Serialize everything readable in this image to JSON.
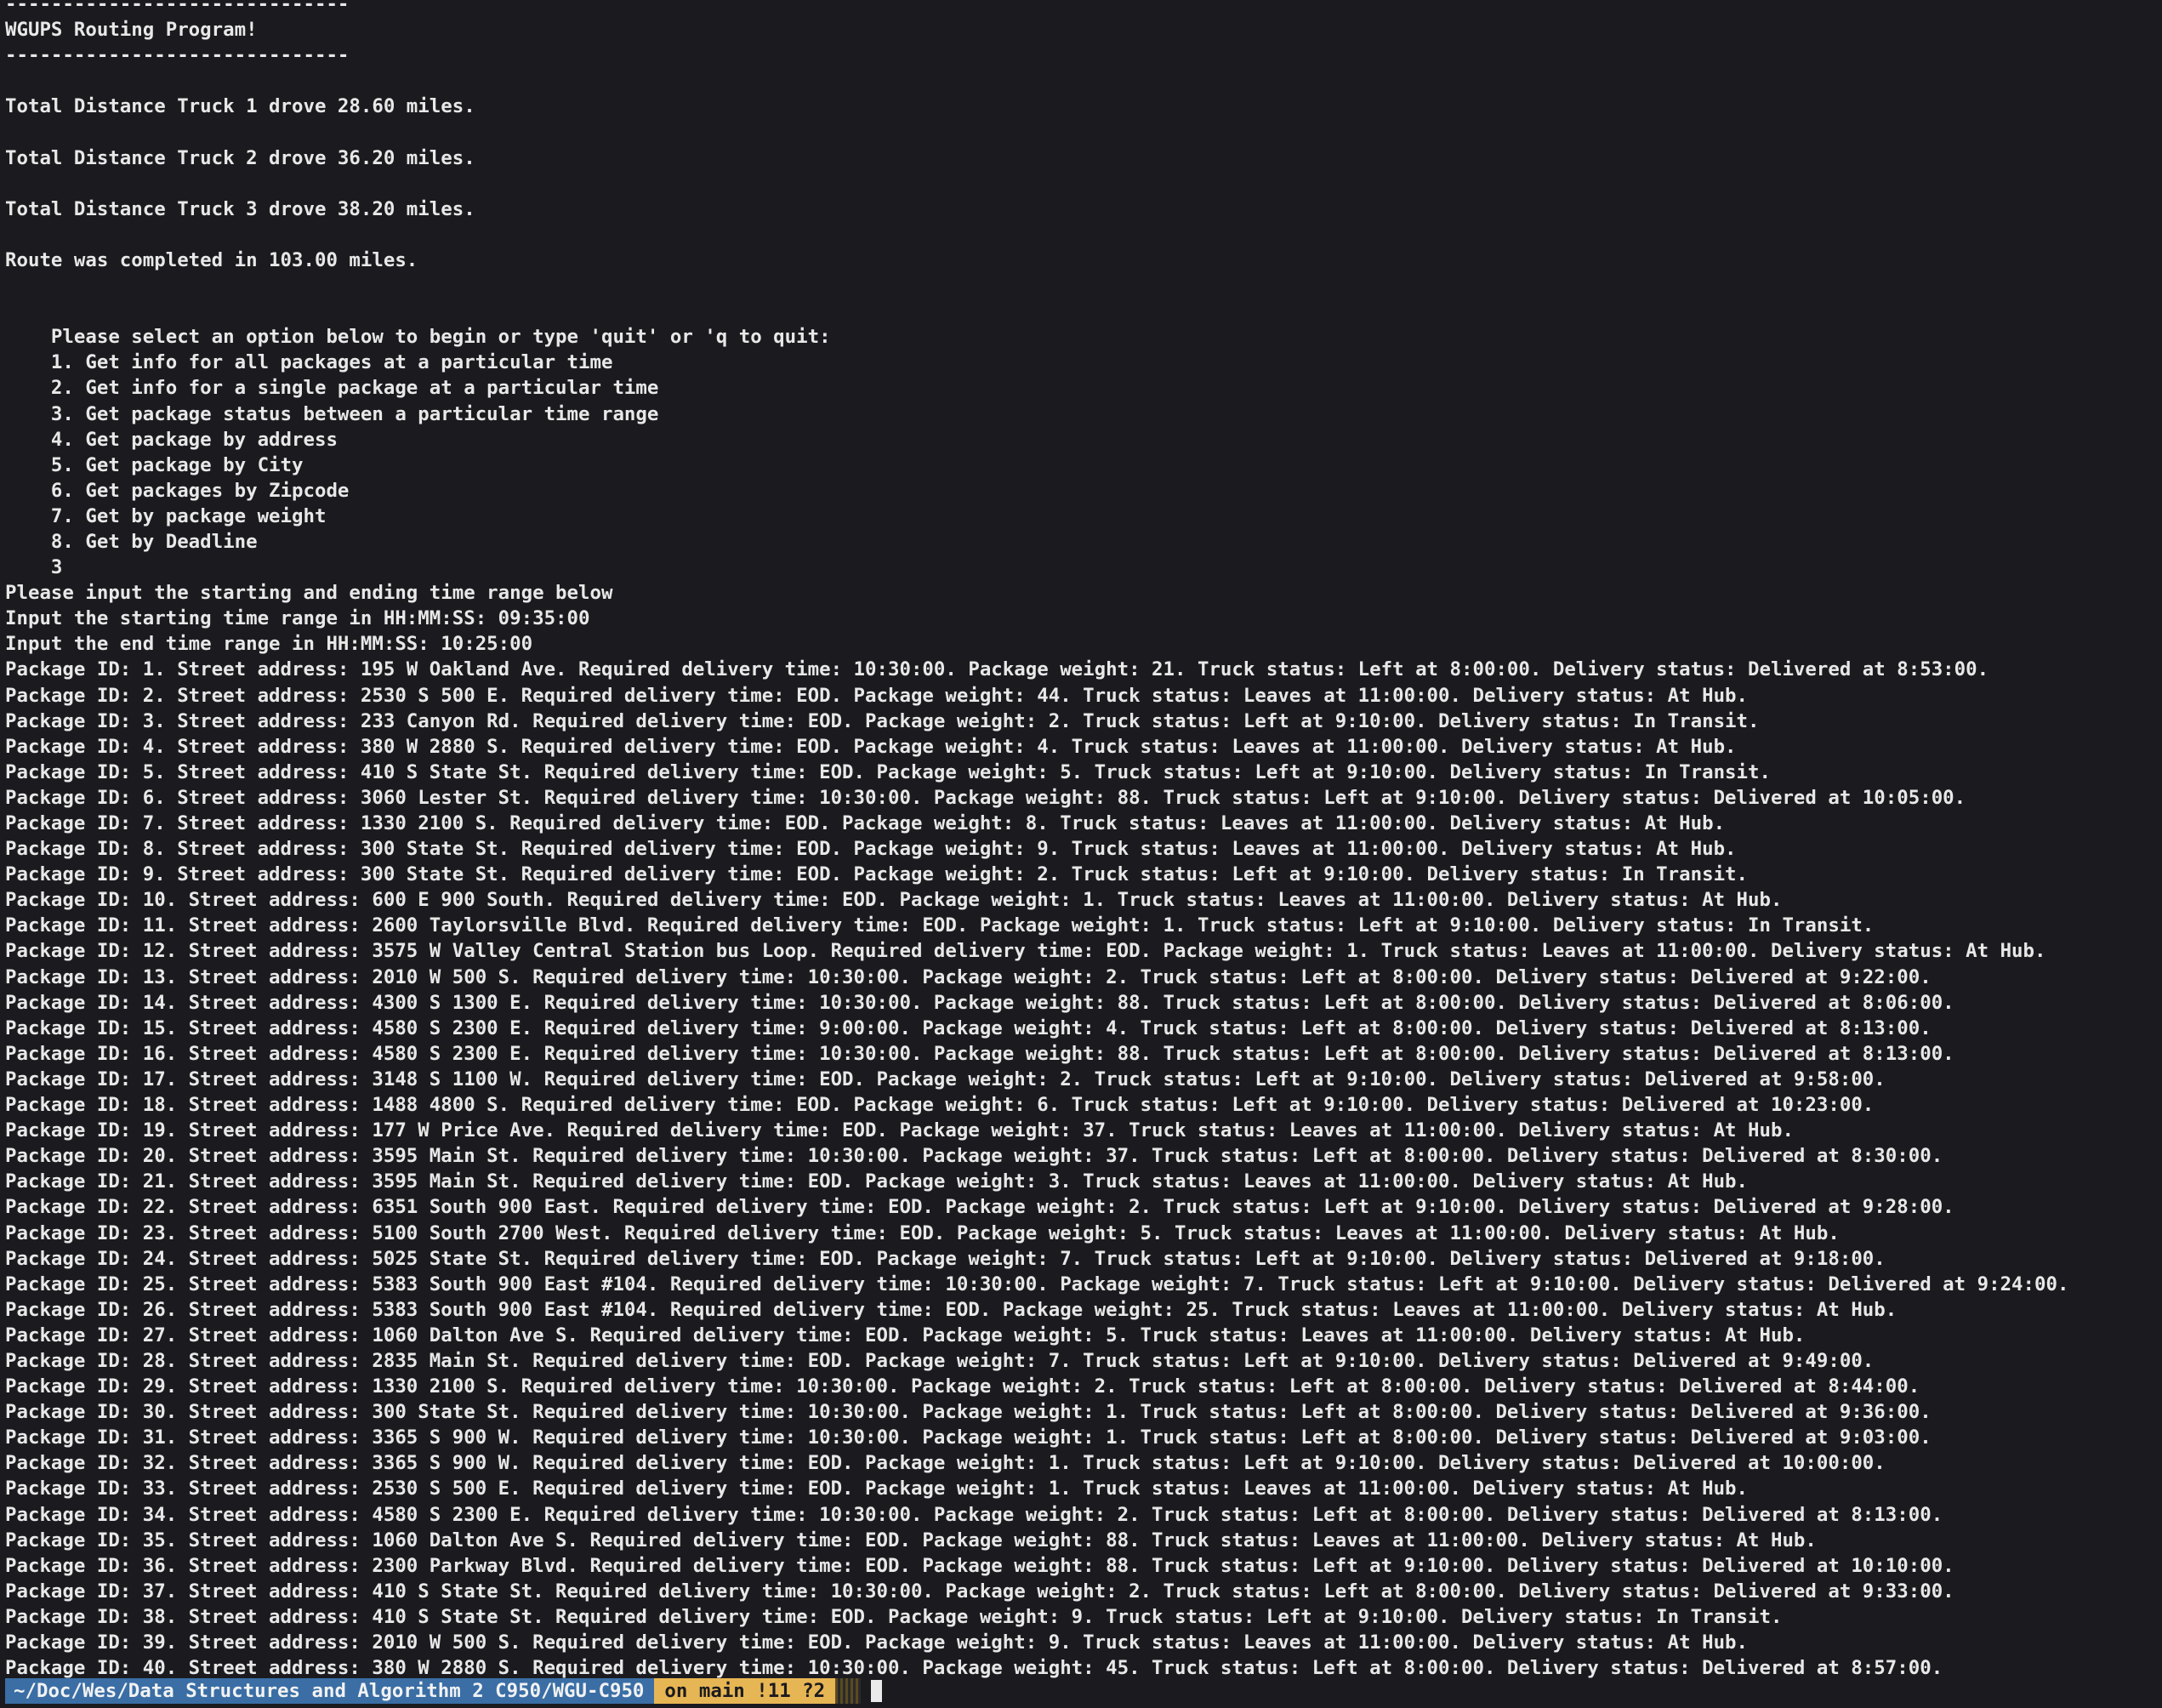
{
  "terminal": {
    "lines": [
      "------------------------------",
      "WGUPS Routing Program!",
      "------------------------------",
      "",
      "Total Distance Truck 1 drove 28.60 miles.",
      "",
      "Total Distance Truck 2 drove 36.20 miles.",
      "",
      "Total Distance Truck 3 drove 38.20 miles.",
      "",
      "Route was completed in 103.00 miles.",
      "",
      "",
      "    Please select an option below to begin or type 'quit' or 'q to quit:",
      "    1. Get info for all packages at a particular time",
      "    2. Get info for a single package at a particular time",
      "    3. Get package status between a particular time range",
      "    4. Get package by address",
      "    5. Get package by City",
      "    6. Get packages by Zipcode",
      "    7. Get by package weight",
      "    8. Get by Deadline",
      "    3",
      "Please input the starting and ending time range below",
      "Input the starting time range in HH:MM:SS: 09:35:00",
      "Input the end time range in HH:MM:SS: 10:25:00",
      "Package ID: 1. Street address: 195 W Oakland Ave. Required delivery time: 10:30:00. Package weight: 21. Truck status: Left at 8:00:00. Delivery status: Delivered at 8:53:00.",
      "Package ID: 2. Street address: 2530 S 500 E. Required delivery time: EOD. Package weight: 44. Truck status: Leaves at 11:00:00. Delivery status: At Hub.",
      "Package ID: 3. Street address: 233 Canyon Rd. Required delivery time: EOD. Package weight: 2. Truck status: Left at 9:10:00. Delivery status: In Transit.",
      "Package ID: 4. Street address: 380 W 2880 S. Required delivery time: EOD. Package weight: 4. Truck status: Leaves at 11:00:00. Delivery status: At Hub.",
      "Package ID: 5. Street address: 410 S State St. Required delivery time: EOD. Package weight: 5. Truck status: Left at 9:10:00. Delivery status: In Transit.",
      "Package ID: 6. Street address: 3060 Lester St. Required delivery time: 10:30:00. Package weight: 88. Truck status: Left at 9:10:00. Delivery status: Delivered at 10:05:00.",
      "Package ID: 7. Street address: 1330 2100 S. Required delivery time: EOD. Package weight: 8. Truck status: Leaves at 11:00:00. Delivery status: At Hub.",
      "Package ID: 8. Street address: 300 State St. Required delivery time: EOD. Package weight: 9. Truck status: Leaves at 11:00:00. Delivery status: At Hub.",
      "Package ID: 9. Street address: 300 State St. Required delivery time: EOD. Package weight: 2. Truck status: Left at 9:10:00. Delivery status: In Transit.",
      "Package ID: 10. Street address: 600 E 900 South. Required delivery time: EOD. Package weight: 1. Truck status: Leaves at 11:00:00. Delivery status: At Hub.",
      "Package ID: 11. Street address: 2600 Taylorsville Blvd. Required delivery time: EOD. Package weight: 1. Truck status: Left at 9:10:00. Delivery status: In Transit.",
      "Package ID: 12. Street address: 3575 W Valley Central Station bus Loop. Required delivery time: EOD. Package weight: 1. Truck status: Leaves at 11:00:00. Delivery status: At Hub.",
      "Package ID: 13. Street address: 2010 W 500 S. Required delivery time: 10:30:00. Package weight: 2. Truck status: Left at 8:00:00. Delivery status: Delivered at 9:22:00.",
      "Package ID: 14. Street address: 4300 S 1300 E. Required delivery time: 10:30:00. Package weight: 88. Truck status: Left at 8:00:00. Delivery status: Delivered at 8:06:00.",
      "Package ID: 15. Street address: 4580 S 2300 E. Required delivery time: 9:00:00. Package weight: 4. Truck status: Left at 8:00:00. Delivery status: Delivered at 8:13:00.",
      "Package ID: 16. Street address: 4580 S 2300 E. Required delivery time: 10:30:00. Package weight: 88. Truck status: Left at 8:00:00. Delivery status: Delivered at 8:13:00.",
      "Package ID: 17. Street address: 3148 S 1100 W. Required delivery time: EOD. Package weight: 2. Truck status: Left at 9:10:00. Delivery status: Delivered at 9:58:00.",
      "Package ID: 18. Street address: 1488 4800 S. Required delivery time: EOD. Package weight: 6. Truck status: Left at 9:10:00. Delivery status: Delivered at 10:23:00.",
      "Package ID: 19. Street address: 177 W Price Ave. Required delivery time: EOD. Package weight: 37. Truck status: Leaves at 11:00:00. Delivery status: At Hub.",
      "Package ID: 20. Street address: 3595 Main St. Required delivery time: 10:30:00. Package weight: 37. Truck status: Left at 8:00:00. Delivery status: Delivered at 8:30:00.",
      "Package ID: 21. Street address: 3595 Main St. Required delivery time: EOD. Package weight: 3. Truck status: Leaves at 11:00:00. Delivery status: At Hub.",
      "Package ID: 22. Street address: 6351 South 900 East. Required delivery time: EOD. Package weight: 2. Truck status: Left at 9:10:00. Delivery status: Delivered at 9:28:00.",
      "Package ID: 23. Street address: 5100 South 2700 West. Required delivery time: EOD. Package weight: 5. Truck status: Leaves at 11:00:00. Delivery status: At Hub.",
      "Package ID: 24. Street address: 5025 State St. Required delivery time: EOD. Package weight: 7. Truck status: Left at 9:10:00. Delivery status: Delivered at 9:18:00.",
      "Package ID: 25. Street address: 5383 South 900 East #104. Required delivery time: 10:30:00. Package weight: 7. Truck status: Left at 9:10:00. Delivery status: Delivered at 9:24:00.",
      "Package ID: 26. Street address: 5383 South 900 East #104. Required delivery time: EOD. Package weight: 25. Truck status: Leaves at 11:00:00. Delivery status: At Hub.",
      "Package ID: 27. Street address: 1060 Dalton Ave S. Required delivery time: EOD. Package weight: 5. Truck status: Leaves at 11:00:00. Delivery status: At Hub.",
      "Package ID: 28. Street address: 2835 Main St. Required delivery time: EOD. Package weight: 7. Truck status: Left at 9:10:00. Delivery status: Delivered at 9:49:00.",
      "Package ID: 29. Street address: 1330 2100 S. Required delivery time: 10:30:00. Package weight: 2. Truck status: Left at 8:00:00. Delivery status: Delivered at 8:44:00.",
      "Package ID: 30. Street address: 300 State St. Required delivery time: 10:30:00. Package weight: 1. Truck status: Left at 8:00:00. Delivery status: Delivered at 9:36:00.",
      "Package ID: 31. Street address: 3365 S 900 W. Required delivery time: 10:30:00. Package weight: 1. Truck status: Left at 8:00:00. Delivery status: Delivered at 9:03:00.",
      "Package ID: 32. Street address: 3365 S 900 W. Required delivery time: EOD. Package weight: 1. Truck status: Left at 9:10:00. Delivery status: Delivered at 10:00:00.",
      "Package ID: 33. Street address: 2530 S 500 E. Required delivery time: EOD. Package weight: 1. Truck status: Leaves at 11:00:00. Delivery status: At Hub.",
      "Package ID: 34. Street address: 4580 S 2300 E. Required delivery time: 10:30:00. Package weight: 2. Truck status: Left at 8:00:00. Delivery status: Delivered at 8:13:00.",
      "Package ID: 35. Street address: 1060 Dalton Ave S. Required delivery time: EOD. Package weight: 88. Truck status: Leaves at 11:00:00. Delivery status: At Hub.",
      "Package ID: 36. Street address: 2300 Parkway Blvd. Required delivery time: EOD. Package weight: 88. Truck status: Left at 9:10:00. Delivery status: Delivered at 10:10:00.",
      "Package ID: 37. Street address: 410 S State St. Required delivery time: 10:30:00. Package weight: 2. Truck status: Left at 8:00:00. Delivery status: Delivered at 9:33:00.",
      "Package ID: 38. Street address: 410 S State St. Required delivery time: EOD. Package weight: 9. Truck status: Left at 9:10:00. Delivery status: In Transit.",
      "Package ID: 39. Street address: 2010 W 500 S. Required delivery time: EOD. Package weight: 9. Truck status: Leaves at 11:00:00. Delivery status: At Hub.",
      "Package ID: 40. Street address: 380 W 2880 S. Required delivery time: 10:30:00. Package weight: 45. Truck status: Left at 8:00:00. Delivery status: Delivered at 8:57:00."
    ]
  },
  "prompt": {
    "path": "~/Doc/Wes/Data Structures and Algorithm 2 C950/WGU-C950",
    "git": "on main !11 ?2"
  },
  "colors": {
    "background": "#1b1b1f",
    "text": "#e8e8e8",
    "path_segment": "#3a6ea5",
    "git_segment": "#e7b654"
  }
}
